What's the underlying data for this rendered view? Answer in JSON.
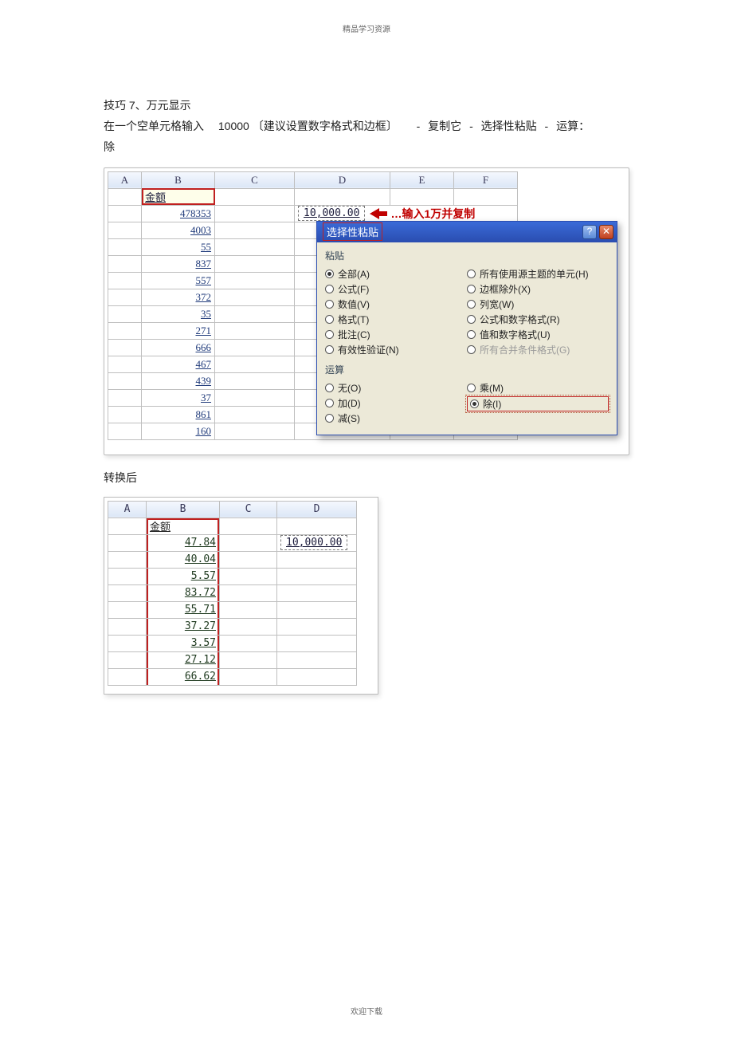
{
  "header_text": "精品学习资源",
  "footer_text": "欢迎下载",
  "tip_title": "技巧 7、万元显示",
  "instr_1": "在一个空单元格输入",
  "instr_num": "10000",
  "instr_2": "〔建议设置数字格式和边框〕",
  "instr_3": "复制它",
  "instr_4": "选择性粘贴",
  "instr_5": "运算：",
  "instr_6": "除",
  "sheet1": {
    "cols": [
      "A",
      "B",
      "C",
      "D",
      "E",
      "F"
    ],
    "header_label": "金额",
    "ten_thousand": "10,000.00",
    "callout": "…输入1万并复制",
    "values": [
      "478353",
      "4003",
      "55",
      "837",
      "557",
      "372",
      "35",
      "271",
      "666",
      "467",
      "439",
      "37",
      "861",
      "160"
    ]
  },
  "dialog": {
    "title": "选择性粘贴",
    "group_paste": "粘贴",
    "group_op": "运算",
    "paste_left": [
      {
        "label": "全部(A)",
        "selected": true
      },
      {
        "label": "公式(F)",
        "selected": false
      },
      {
        "label": "数值(V)",
        "selected": false
      },
      {
        "label": "格式(T)",
        "selected": false
      },
      {
        "label": "批注(C)",
        "selected": false
      },
      {
        "label": "有效性验证(N)",
        "selected": false
      }
    ],
    "paste_right": [
      {
        "label": "所有使用源主题的单元(H)",
        "selected": false,
        "disabled": false
      },
      {
        "label": "边框除外(X)",
        "selected": false
      },
      {
        "label": "列宽(W)",
        "selected": false
      },
      {
        "label": "公式和数字格式(R)",
        "selected": false
      },
      {
        "label": "值和数字格式(U)",
        "selected": false
      },
      {
        "label": "所有合并条件格式(G)",
        "selected": false,
        "disabled": true
      }
    ],
    "op_left": [
      {
        "label": "无(O)",
        "selected": false
      },
      {
        "label": "加(D)",
        "selected": false
      },
      {
        "label": "减(S)",
        "selected": false
      }
    ],
    "op_right": [
      {
        "label": "乘(M)",
        "selected": false
      },
      {
        "label": "除(I)",
        "selected": true,
        "focused": true
      }
    ]
  },
  "after_label": "转换后",
  "sheet2": {
    "cols": [
      "A",
      "B",
      "C",
      "D"
    ],
    "header_label": "金额",
    "ten_thousand": "10,000.00",
    "values": [
      "47.84",
      "40.04",
      "5.57",
      "83.72",
      "55.71",
      "37.27",
      "3.57",
      "27.12",
      "66.62"
    ]
  }
}
